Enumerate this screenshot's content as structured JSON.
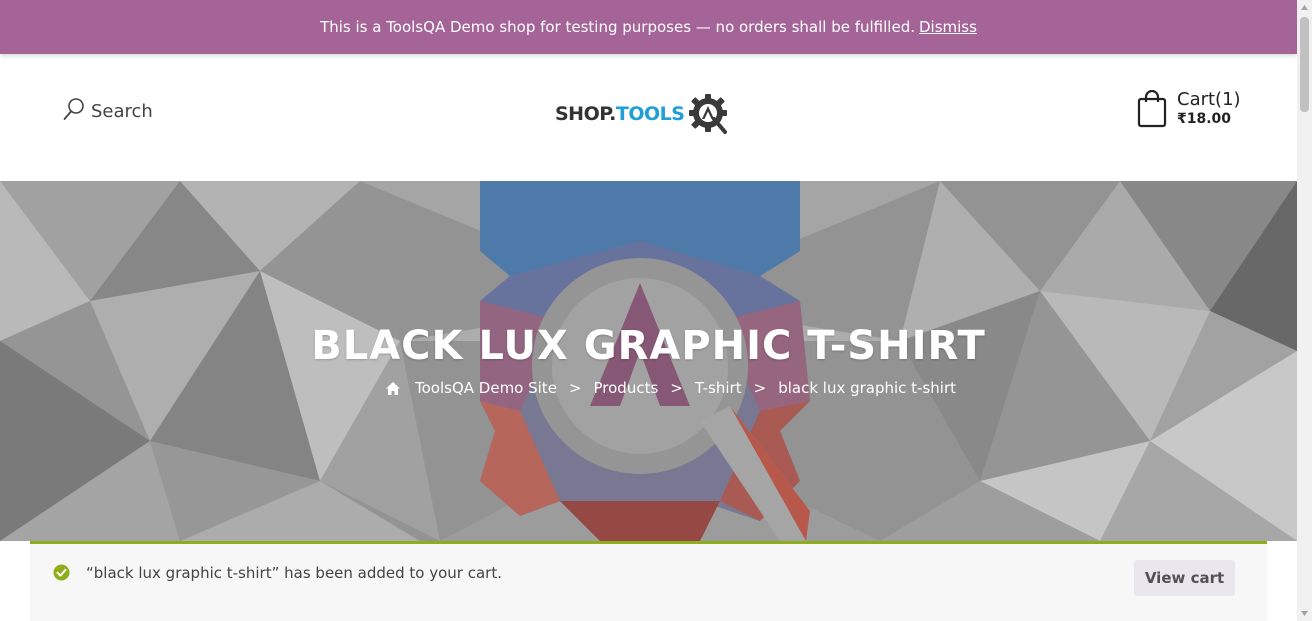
{
  "notice": {
    "text": "This is a ToolsQA Demo shop for testing purposes — no orders shall be fulfilled.",
    "dismiss_label": "Dismiss"
  },
  "header": {
    "search_label": "Search",
    "logo": {
      "text_dark": "SHOP.",
      "text_blue": "TOOLS",
      "alt": "SHOP.TOOLSQA"
    },
    "cart": {
      "label": "Cart(1)",
      "amount": "₹18.00"
    }
  },
  "hero": {
    "title": "BLACK LUX GRAPHIC T-SHIRT",
    "breadcrumb": [
      {
        "label": "ToolsQA Demo Site"
      },
      {
        "label": "Products"
      },
      {
        "label": "T-shirt"
      },
      {
        "label": "black lux graphic t-shirt"
      }
    ],
    "separator": ">"
  },
  "message": {
    "text": "“black lux graphic t-shirt” has been added to your cart.",
    "button_label": "View cart"
  },
  "colors": {
    "notice_bg": "#a46497",
    "success_border": "#8fae1b",
    "logo_blue": "#1f9fd8"
  },
  "icons": [
    "search-icon",
    "logo-gear-icon",
    "cart-bag-icon",
    "home-icon",
    "check-circle-icon"
  ]
}
